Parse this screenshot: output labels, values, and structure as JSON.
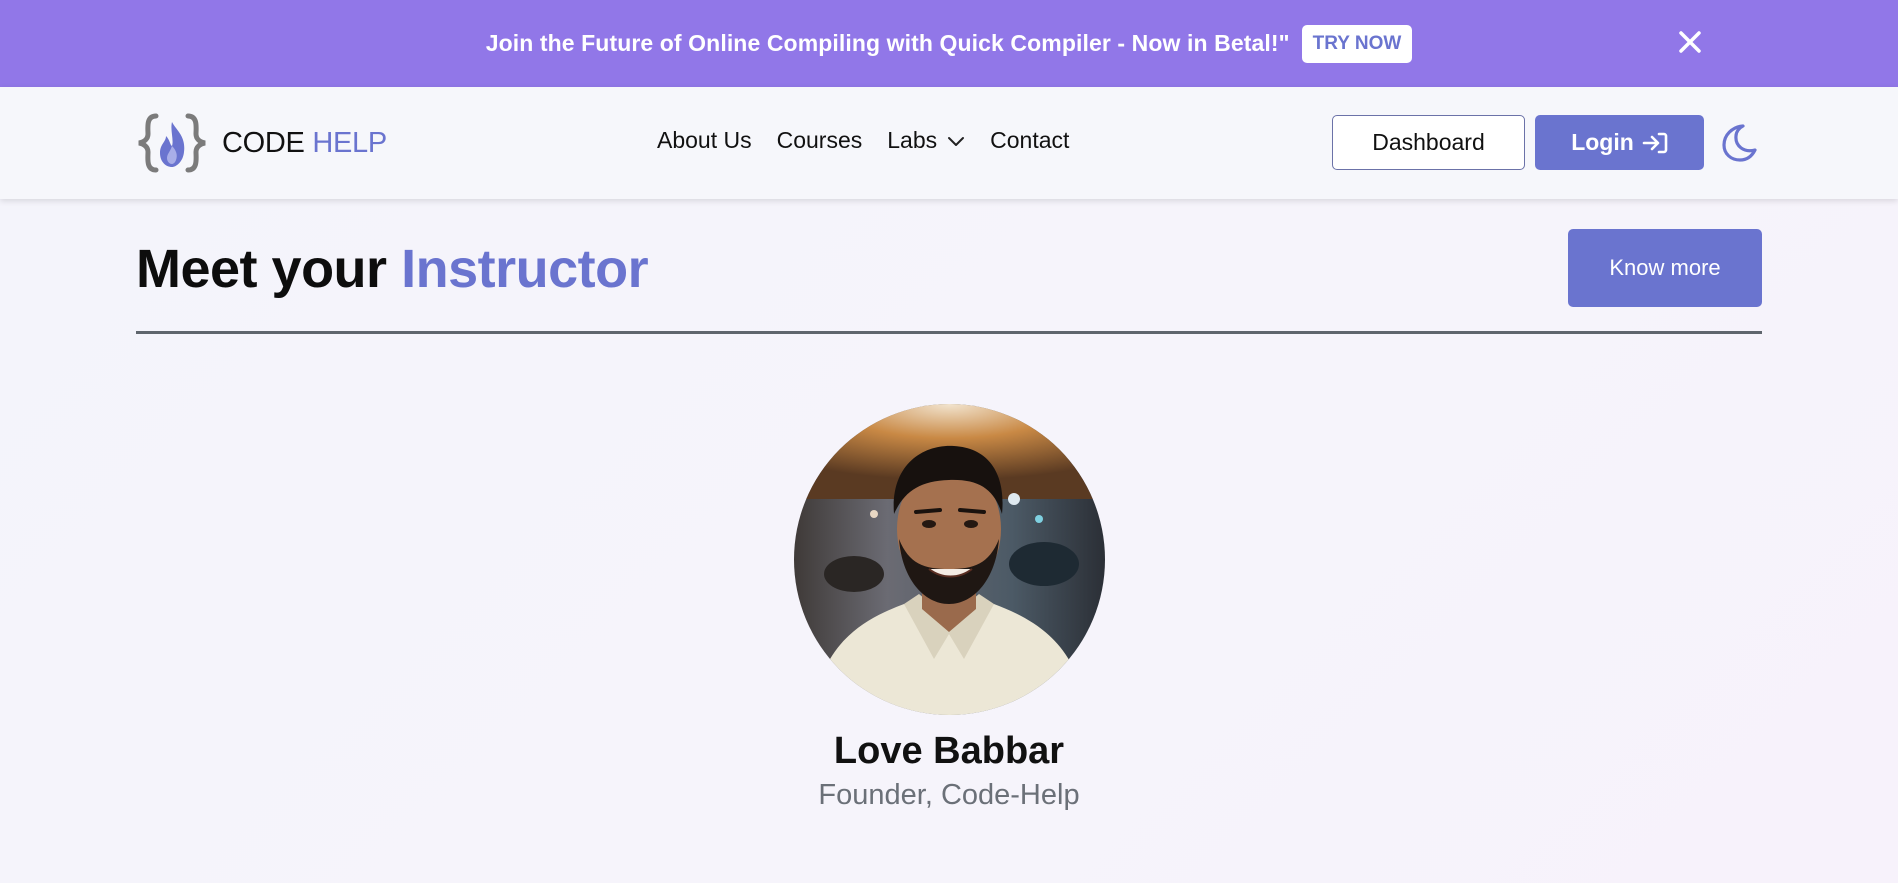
{
  "banner": {
    "message": "Join the Future of Online Compiling with Quick Compiler - Now in Betal!\"",
    "cta_label": "TRY NOW"
  },
  "navbar": {
    "logo": {
      "code": "CODE",
      "help": "HELP"
    },
    "links": [
      {
        "label": "About Us"
      },
      {
        "label": "Courses"
      },
      {
        "label": "Labs"
      },
      {
        "label": "Contact"
      }
    ],
    "dashboard_label": "Dashboard",
    "login_label": "Login"
  },
  "section": {
    "title_prefix": "Meet your",
    "title_accent": "Instructor",
    "know_more_label": "Know more"
  },
  "instructor": {
    "name": "Love Babbar",
    "role": "Founder, Code-Help"
  },
  "colors": {
    "banner": "#9177e8",
    "accent": "#6a74cf",
    "navbar_bg": "#f6f7fb"
  },
  "icons": {
    "banner_close": "close-icon",
    "logo": "code-flame-logo-icon",
    "labs_dropdown": "chevron-down-icon",
    "login": "sign-in-icon",
    "theme_toggle": "moon-icon"
  }
}
